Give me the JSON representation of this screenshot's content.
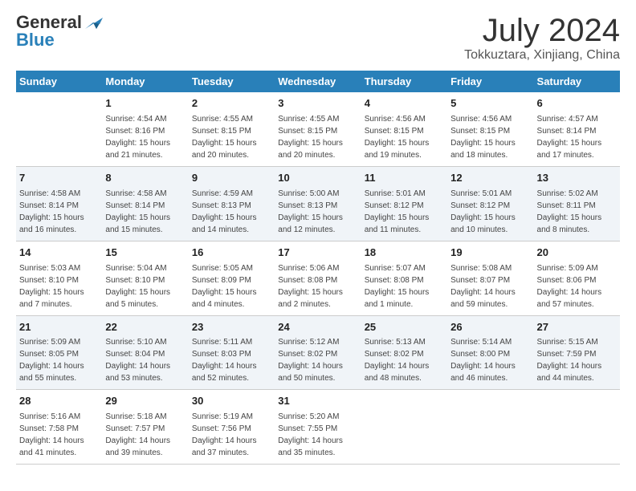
{
  "header": {
    "logo_line1": "General",
    "logo_line2": "Blue",
    "month": "July 2024",
    "location": "Tokkuztara, Xinjiang, China"
  },
  "weekdays": [
    "Sunday",
    "Monday",
    "Tuesday",
    "Wednesday",
    "Thursday",
    "Friday",
    "Saturday"
  ],
  "weeks": [
    [
      {
        "day": "",
        "info": ""
      },
      {
        "day": "1",
        "info": "Sunrise: 4:54 AM\nSunset: 8:16 PM\nDaylight: 15 hours\nand 21 minutes."
      },
      {
        "day": "2",
        "info": "Sunrise: 4:55 AM\nSunset: 8:15 PM\nDaylight: 15 hours\nand 20 minutes."
      },
      {
        "day": "3",
        "info": "Sunrise: 4:55 AM\nSunset: 8:15 PM\nDaylight: 15 hours\nand 20 minutes."
      },
      {
        "day": "4",
        "info": "Sunrise: 4:56 AM\nSunset: 8:15 PM\nDaylight: 15 hours\nand 19 minutes."
      },
      {
        "day": "5",
        "info": "Sunrise: 4:56 AM\nSunset: 8:15 PM\nDaylight: 15 hours\nand 18 minutes."
      },
      {
        "day": "6",
        "info": "Sunrise: 4:57 AM\nSunset: 8:14 PM\nDaylight: 15 hours\nand 17 minutes."
      }
    ],
    [
      {
        "day": "7",
        "info": "Sunrise: 4:58 AM\nSunset: 8:14 PM\nDaylight: 15 hours\nand 16 minutes."
      },
      {
        "day": "8",
        "info": "Sunrise: 4:58 AM\nSunset: 8:14 PM\nDaylight: 15 hours\nand 15 minutes."
      },
      {
        "day": "9",
        "info": "Sunrise: 4:59 AM\nSunset: 8:13 PM\nDaylight: 15 hours\nand 14 minutes."
      },
      {
        "day": "10",
        "info": "Sunrise: 5:00 AM\nSunset: 8:13 PM\nDaylight: 15 hours\nand 12 minutes."
      },
      {
        "day": "11",
        "info": "Sunrise: 5:01 AM\nSunset: 8:12 PM\nDaylight: 15 hours\nand 11 minutes."
      },
      {
        "day": "12",
        "info": "Sunrise: 5:01 AM\nSunset: 8:12 PM\nDaylight: 15 hours\nand 10 minutes."
      },
      {
        "day": "13",
        "info": "Sunrise: 5:02 AM\nSunset: 8:11 PM\nDaylight: 15 hours\nand 8 minutes."
      }
    ],
    [
      {
        "day": "14",
        "info": "Sunrise: 5:03 AM\nSunset: 8:10 PM\nDaylight: 15 hours\nand 7 minutes."
      },
      {
        "day": "15",
        "info": "Sunrise: 5:04 AM\nSunset: 8:10 PM\nDaylight: 15 hours\nand 5 minutes."
      },
      {
        "day": "16",
        "info": "Sunrise: 5:05 AM\nSunset: 8:09 PM\nDaylight: 15 hours\nand 4 minutes."
      },
      {
        "day": "17",
        "info": "Sunrise: 5:06 AM\nSunset: 8:08 PM\nDaylight: 15 hours\nand 2 minutes."
      },
      {
        "day": "18",
        "info": "Sunrise: 5:07 AM\nSunset: 8:08 PM\nDaylight: 15 hours\nand 1 minute."
      },
      {
        "day": "19",
        "info": "Sunrise: 5:08 AM\nSunset: 8:07 PM\nDaylight: 14 hours\nand 59 minutes."
      },
      {
        "day": "20",
        "info": "Sunrise: 5:09 AM\nSunset: 8:06 PM\nDaylight: 14 hours\nand 57 minutes."
      }
    ],
    [
      {
        "day": "21",
        "info": "Sunrise: 5:09 AM\nSunset: 8:05 PM\nDaylight: 14 hours\nand 55 minutes."
      },
      {
        "day": "22",
        "info": "Sunrise: 5:10 AM\nSunset: 8:04 PM\nDaylight: 14 hours\nand 53 minutes."
      },
      {
        "day": "23",
        "info": "Sunrise: 5:11 AM\nSunset: 8:03 PM\nDaylight: 14 hours\nand 52 minutes."
      },
      {
        "day": "24",
        "info": "Sunrise: 5:12 AM\nSunset: 8:02 PM\nDaylight: 14 hours\nand 50 minutes."
      },
      {
        "day": "25",
        "info": "Sunrise: 5:13 AM\nSunset: 8:02 PM\nDaylight: 14 hours\nand 48 minutes."
      },
      {
        "day": "26",
        "info": "Sunrise: 5:14 AM\nSunset: 8:00 PM\nDaylight: 14 hours\nand 46 minutes."
      },
      {
        "day": "27",
        "info": "Sunrise: 5:15 AM\nSunset: 7:59 PM\nDaylight: 14 hours\nand 44 minutes."
      }
    ],
    [
      {
        "day": "28",
        "info": "Sunrise: 5:16 AM\nSunset: 7:58 PM\nDaylight: 14 hours\nand 41 minutes."
      },
      {
        "day": "29",
        "info": "Sunrise: 5:18 AM\nSunset: 7:57 PM\nDaylight: 14 hours\nand 39 minutes."
      },
      {
        "day": "30",
        "info": "Sunrise: 5:19 AM\nSunset: 7:56 PM\nDaylight: 14 hours\nand 37 minutes."
      },
      {
        "day": "31",
        "info": "Sunrise: 5:20 AM\nSunset: 7:55 PM\nDaylight: 14 hours\nand 35 minutes."
      },
      {
        "day": "",
        "info": ""
      },
      {
        "day": "",
        "info": ""
      },
      {
        "day": "",
        "info": ""
      }
    ]
  ]
}
